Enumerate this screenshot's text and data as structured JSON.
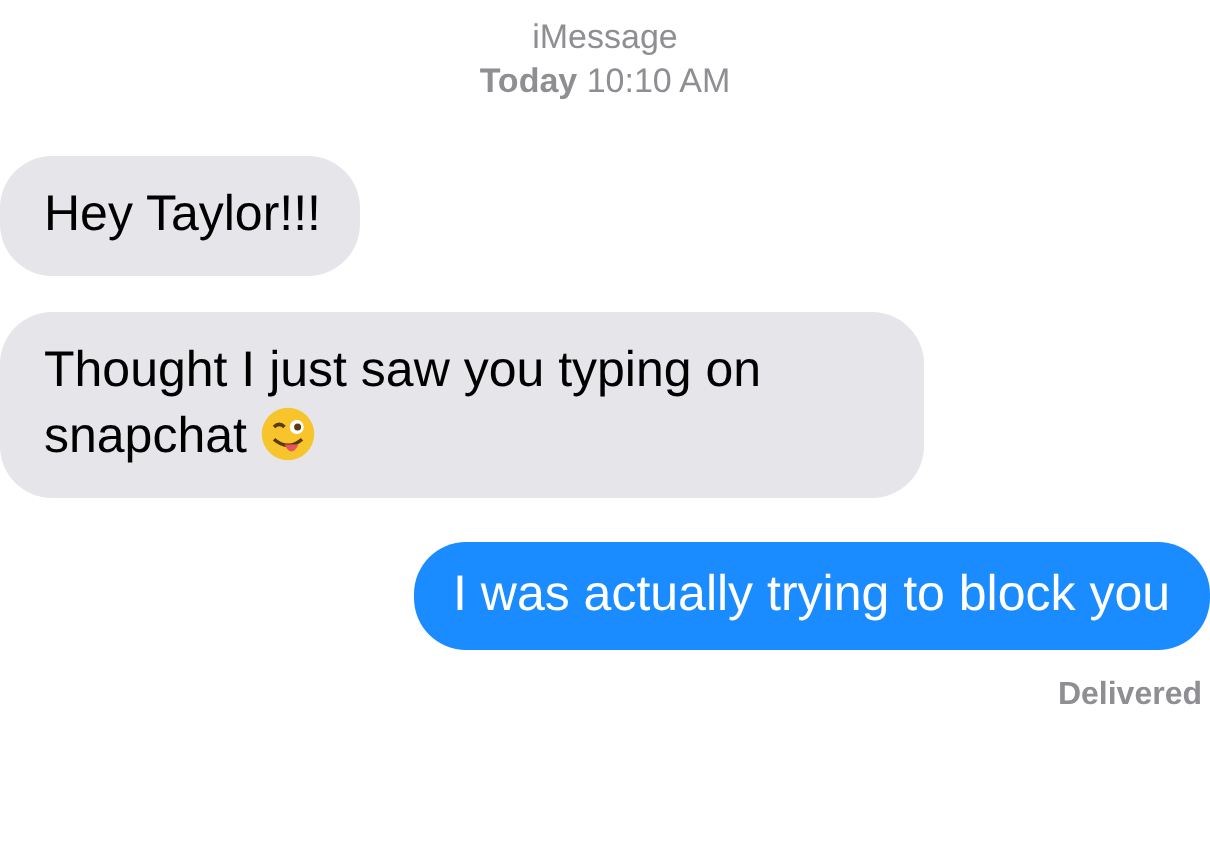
{
  "header": {
    "service": "iMessage",
    "timestamp": "**Today** 10:10 AM"
  },
  "messages": [
    {
      "kind": "incoming",
      "text": "Hey Taylor!!!",
      "has_emoji": false
    },
    {
      "kind": "incoming",
      "text": "Thought I just saw you typing on snapchat",
      "has_emoji": true
    },
    {
      "kind": "outgoing",
      "text": "I was actually trying to block you",
      "has_emoji": false
    }
  ],
  "status": "Delivered"
}
